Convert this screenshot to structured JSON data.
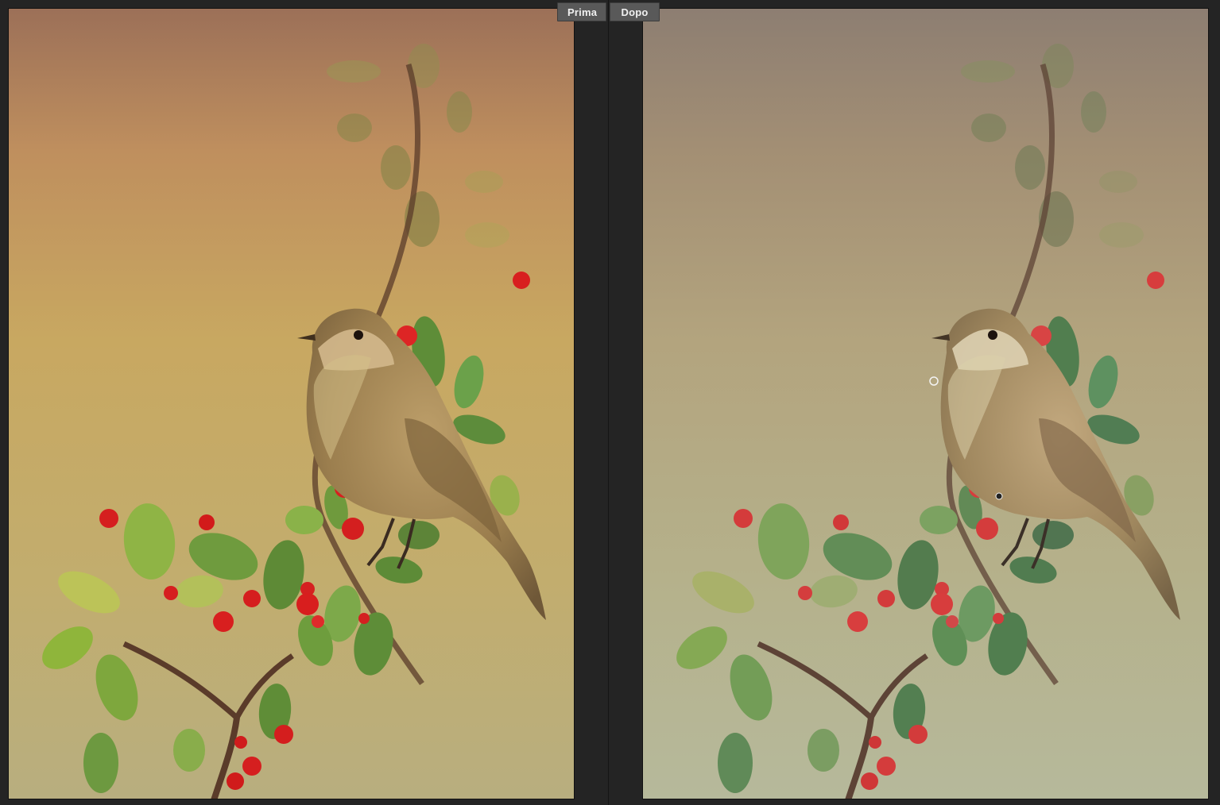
{
  "comparison": {
    "before_label": "Prima",
    "after_label": "Dopo"
  },
  "images": {
    "before": {
      "icon": "photo-bird-before",
      "tone": "warm"
    },
    "after": {
      "icon": "photo-bird-after",
      "tone": "cool"
    }
  },
  "colors": {
    "ui_background": "#262626",
    "tab_background": "#595959",
    "tab_text": "#f0f0f0",
    "before_bg_top": "#9f7459",
    "before_bg_mid": "#cba65f",
    "before_bg_bottom": "#b9ae7b",
    "after_bg_top": "#8e7f73",
    "after_bg_mid": "#b5ac82",
    "after_bg_bottom": "#b6b898"
  }
}
